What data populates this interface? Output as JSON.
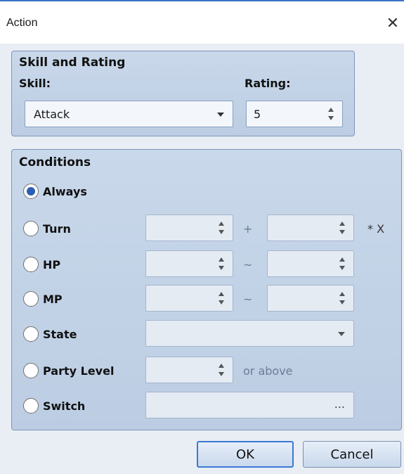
{
  "window": {
    "title": "Action",
    "close_glyph": "✕"
  },
  "skill_rating": {
    "title": "Skill and Rating",
    "skill_label": "Skill:",
    "skill_value": "Attack",
    "rating_label": "Rating:",
    "rating_value": "5"
  },
  "conditions": {
    "title": "Conditions",
    "selected": "Always",
    "options": {
      "always": "Always",
      "turn": "Turn",
      "hp": "HP",
      "mp": "MP",
      "state": "State",
      "party_level": "Party Level",
      "switch": "Switch"
    },
    "turn_plus": "+",
    "turn_suffix": "* X",
    "hp_tilde": "~",
    "mp_tilde": "~",
    "party_level_suffix": "or above",
    "switch_ellipsis": "..."
  },
  "buttons": {
    "ok": "OK",
    "cancel": "Cancel"
  }
}
